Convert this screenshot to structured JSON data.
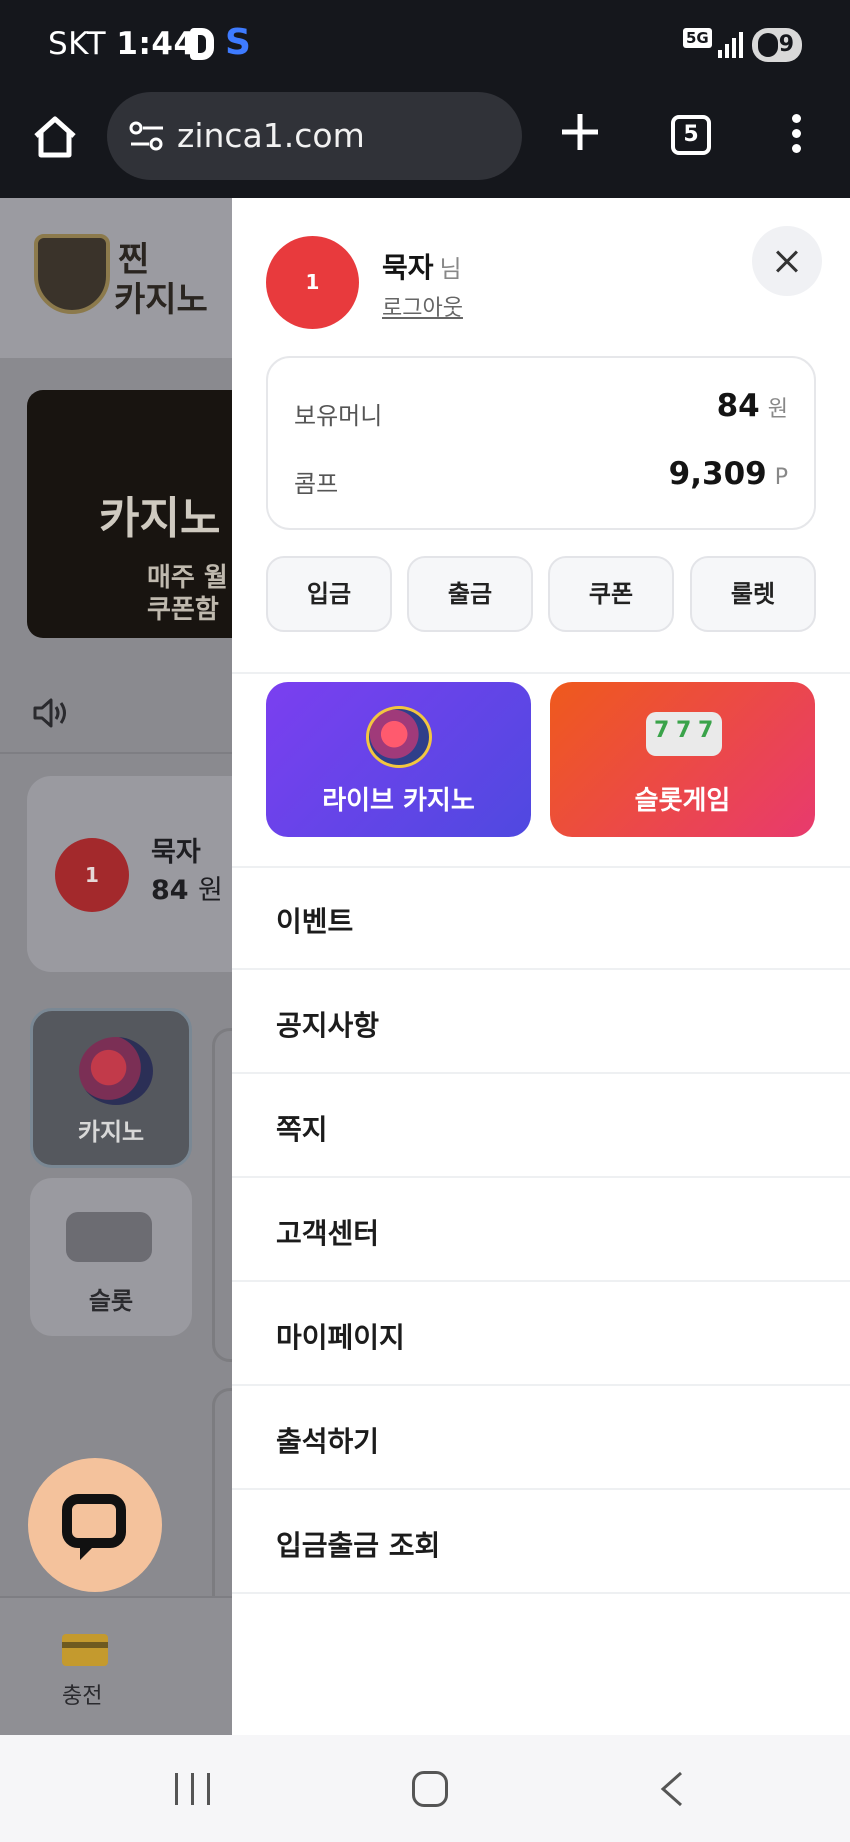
{
  "status_bar": {
    "carrier": "SKT",
    "time": "1:44",
    "app_s": "S",
    "network": "5G",
    "battery": "9"
  },
  "browser": {
    "url": "zinca1.com",
    "tab_count": "5"
  },
  "page": {
    "banner_title": "카지노",
    "banner_sub1": "매주 월",
    "banner_sub2": "쿠폰함",
    "user_name": "묵자",
    "user_level": "1",
    "user_money": "84",
    "user_money_unit": "원",
    "categories": [
      "카지노",
      "슬롯"
    ],
    "bottom_nav": [
      "충전"
    ]
  },
  "drawer": {
    "level": "1",
    "user_name": "묵자",
    "user_suffix": "님",
    "logout": "로그아웃",
    "balance": {
      "money_label": "보유머니",
      "money_value": "84",
      "money_unit": "원",
      "comp_label": "콤프",
      "comp_value": "9,309",
      "comp_unit": "P"
    },
    "quick_actions": [
      "입금",
      "출금",
      "쿠폰",
      "룰렛"
    ],
    "games": {
      "live_casino": "라이브 카지노",
      "slot_game": "슬롯게임"
    },
    "menu": [
      "이벤트",
      "공지사항",
      "쪽지",
      "고객센터",
      "마이페이지",
      "출석하기",
      "입금출금 조회"
    ]
  },
  "colors": {
    "level_badge": "#e83a3d",
    "live_casino_start": "#7b3ff0",
    "live_casino_end": "#4f49e0",
    "slot_start": "#ef5a1c",
    "slot_end": "#e83a6e",
    "chat_button": "#f4c29c"
  }
}
